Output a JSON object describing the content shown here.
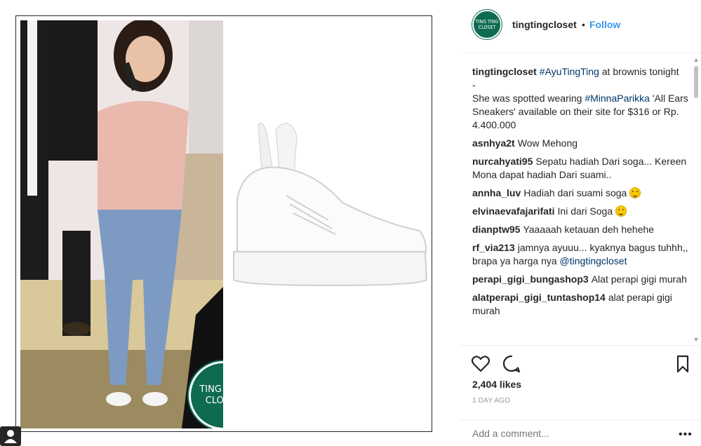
{
  "post": {
    "watermark_brand": "TING TING CLOSET"
  },
  "header": {
    "avatar_text": "TING TING CLOSET",
    "username": "tingtingcloset",
    "separator": "•",
    "follow_label": "Follow"
  },
  "caption": {
    "username": "tingtingcloset",
    "text_1": "",
    "tag_1": "#AyuTingTing",
    "text_2": " at brownis tonight",
    "dash": "-",
    "text_3": "She was spotted wearing ",
    "tag_2": "#MinnaParikka",
    "text_4": " 'All Ears Sneakers' available on their site for $316 or Rp. 4.400.000"
  },
  "comments": [
    {
      "user": "asnhya2t",
      "text": "Wow Mehong"
    },
    {
      "user": "nurcahyati95",
      "text": "Sepatu hadiah Dari soga... Kereen Mona dapat hadiah Dari suami.."
    },
    {
      "user": "annha_luv",
      "text": "Hadiah dari suami soga"
    },
    {
      "user": "elvinaevafajarifati",
      "text": "Ini dari Soga"
    },
    {
      "user": "dianptw95",
      "text": "Yaaaaah ketauan deh hehehe"
    },
    {
      "user": "rf_via213",
      "text": "jamnya ayuuu... kyaknya bagus tuhhh,, brapa ya harga nya ",
      "mention": "@tingtingcloset"
    },
    {
      "user": "perapi_gigi_bungashop3",
      "text": "Alat perapi gigi murah"
    },
    {
      "user": "alatperapi_gigi_tuntashop14",
      "text": "alat perapi gigi murah"
    }
  ],
  "actions": {
    "likes": "2,404 likes",
    "timestamp": "1 DAY AGO",
    "add_comment_placeholder": "Add a comment...",
    "more": "•••"
  }
}
